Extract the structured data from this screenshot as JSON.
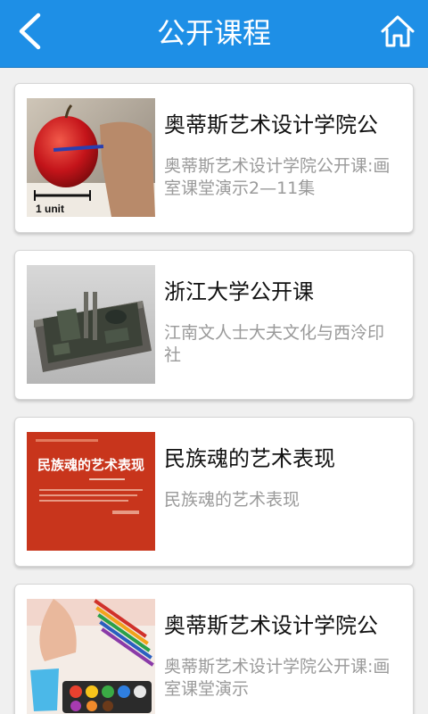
{
  "header": {
    "title": "公开课程",
    "back_icon": "chevron-left-icon",
    "home_icon": "home-icon",
    "bar_color": "#1e8fe6"
  },
  "courses": [
    {
      "title": "奥蒂斯艺术设计学院公",
      "description": "奥蒂斯艺术设计学院公开课:画室课堂演示2—11集",
      "thumb_caption": "1 unit"
    },
    {
      "title": "浙江大学公开课",
      "description": "江南文人士大夫文化与西泠印社"
    },
    {
      "title": "民族魂的艺术表现",
      "description": "民族魂的艺术表现",
      "thumb_caption": "民族魂的艺术表现"
    },
    {
      "title": "奥蒂斯艺术设计学院公",
      "description": "奥蒂斯艺术设计学院公开课:画室课堂演示"
    }
  ]
}
